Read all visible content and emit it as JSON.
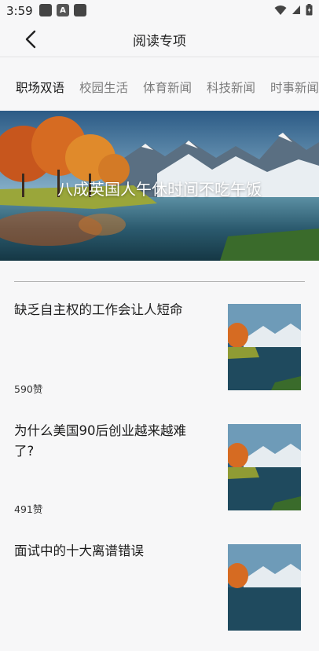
{
  "status": {
    "time": "3:59"
  },
  "header": {
    "title": "阅读专项"
  },
  "tabs": [
    "职场双语",
    "校园生活",
    "体育新闻",
    "科技新闻",
    "时事新闻"
  ],
  "banner": {
    "title": "八成英国人午休时间不吃午饭"
  },
  "articles": [
    {
      "title": "缺乏自主权的工作会让人短命",
      "likes": "590赞"
    },
    {
      "title": "为什么美国90后创业越来越难了?",
      "likes": "491赞"
    },
    {
      "title": "面试中的十大离谱错误",
      "likes": ""
    }
  ],
  "colors": {
    "active_tab": "#1a1a1a",
    "inactive_tab": "#7b7b7b",
    "background": "#f7f7f8"
  }
}
